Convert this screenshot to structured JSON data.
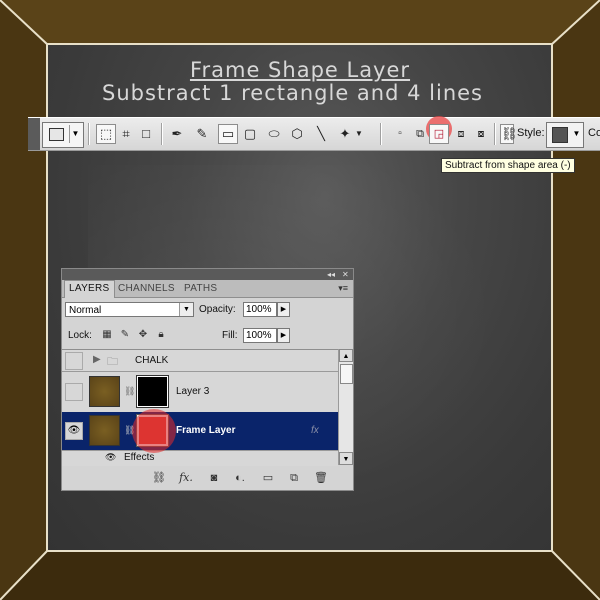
{
  "caption": {
    "title": "Frame Shape Layer",
    "subtitle": "Substract 1 rectangle and 4 lines"
  },
  "options_bar": {
    "style_label": "Style:",
    "truncated_label": "Co",
    "tooltip": "Subtract from shape area (-)",
    "icons": [
      "shape-layers-icon",
      "paths-icon",
      "fill-pixels-icon",
      "pen-icon",
      "freeform-pen-icon",
      "rectangle-icon",
      "rounded-rectangle-icon",
      "ellipse-icon",
      "polygon-icon",
      "line-icon",
      "custom-shape-icon",
      "new-shape-layer-icon",
      "add-to-shape-area-icon",
      "subtract-from-shape-area-icon",
      "intersect-shape-areas-icon",
      "exclude-overlapping-icon",
      "link-icon"
    ],
    "selected_operation": "subtract-from-shape-area"
  },
  "layers_panel": {
    "tabs": [
      "LAYERS",
      "CHANNELS",
      "PATHS"
    ],
    "active_tab": "LAYERS",
    "blend_mode": "Normal",
    "opacity_label": "Opacity:",
    "opacity": "100%",
    "lock_label": "Lock:",
    "fill_label": "Fill:",
    "fill": "100%",
    "layers": [
      {
        "name": "CHALK",
        "type": "group",
        "visible": false,
        "selected": false
      },
      {
        "name": "Layer 3",
        "type": "layer",
        "visible": false,
        "selected": false
      },
      {
        "name": "Frame Layer",
        "type": "shape",
        "visible": true,
        "selected": true
      }
    ],
    "effects_label": "Effects"
  },
  "colors": {
    "frame_brown": "#4a3612",
    "board": "#454545",
    "selection": "#0a246a",
    "highlight_red": "#e64646",
    "vector_mask_red": "#d3443c"
  }
}
